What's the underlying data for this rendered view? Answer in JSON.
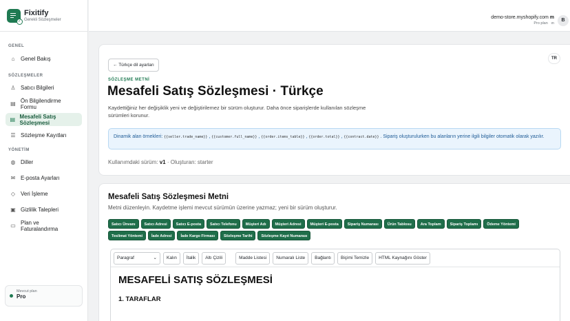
{
  "app": {
    "name": "Fixitify",
    "tagline": "Gerekli Sözleşmeler"
  },
  "sidebar": {
    "sections": {
      "general": "GENEL",
      "contracts": "SÖZLEŞMELER",
      "management": "YÖNETİM"
    },
    "items": [
      {
        "label": "Genel Bakış",
        "icon": "home-icon"
      },
      {
        "label": "Satıcı Bilgileri",
        "icon": "person-icon"
      },
      {
        "label": "Ön Bilgilendirme Formu",
        "icon": "document-icon"
      },
      {
        "label": "Mesafeli Satış Sözleşmesi",
        "icon": "document-icon",
        "active": true
      },
      {
        "label": "Sözleşme Kayıtları",
        "icon": "list-icon"
      },
      {
        "label": "Diller",
        "icon": "globe-icon"
      },
      {
        "label": "E-posta Ayarları",
        "icon": "mail-icon"
      },
      {
        "label": "Veri İşleme",
        "icon": "shield-icon"
      },
      {
        "label": "Gizlilik Talepleri",
        "icon": "lock-icon"
      },
      {
        "label": "Plan ve Faturalandırma",
        "icon": "card-icon"
      }
    ],
    "plan": {
      "label": "Mevcut plan",
      "value": "Pro"
    }
  },
  "topbar": {
    "store": "demo-store.myshopify.com",
    "plan": "Pro plan",
    "avatar": "B",
    "partial_top": "m",
    "partial_bottom": "ın"
  },
  "header_card": {
    "back": "← Türkçe dil ayarları",
    "lang_badge": "TR",
    "eyebrow": "SÖZLEŞME METNİ",
    "title": "Mesafeli Satış Sözleşmesi · Türkçe",
    "description": "Kaydettiğiniz her değişiklik yeni ve değiştirilemez bir sürüm oluşturur. Daha önce siparişlerde kullanılan sözleşme sürümleri korunur.",
    "info_prefix": "Dinamik alan örnekleri:",
    "info_codes": [
      "{{seller.trade_name}}",
      "{{customer.full_name}}",
      "{{order.items_table}}",
      "{{order.total}}",
      "{{contract.date}}"
    ],
    "info_suffix": "Sipariş oluşturulurken bu alanların yerine ilgili bilgiler otomatik olarak yazılır.",
    "version_label": "Kullanımdaki sürüm:",
    "version_value": "v1",
    "version_source": "· Oluşturan: starter"
  },
  "editor_card": {
    "title": "Mesafeli Satış Sözleşmesi Metni",
    "subtitle": "Metni düzenleyin. Kaydetme işlemi mevcut sürümün üzerine yazmaz; yeni bir sürüm oluşturur.",
    "chips": [
      "Satıcı Ünvanı",
      "Satıcı Adresi",
      "Satıcı E-posta",
      "Satıcı Telefonu",
      "Müşteri Adı",
      "Müşteri Adresi",
      "Müşteri E-posta",
      "Sipariş Numarası",
      "Ürün Tablosu",
      "Ara Toplam",
      "Sipariş Toplamı",
      "Ödeme Yöntemi",
      "Teslimat Yöntemi",
      "İade Adresi",
      "İade Kargo Firması",
      "Sözleşme Tarihi",
      "Sözleşme Kayıt Numarası"
    ],
    "toolbar": {
      "format": "Paragraf",
      "buttons": [
        "Kalın",
        "İtalik",
        "Altı Çizili"
      ],
      "buttons2": [
        "Madde Listesi",
        "Numaralı Liste",
        "Bağlantı",
        "Biçimi Temizle",
        "HTML Kaynağını Göster"
      ]
    },
    "doc_heading": "MESAFELİ SATIŞ SÖZLEŞMESİ",
    "doc_section": "1. TARAFLAR"
  }
}
